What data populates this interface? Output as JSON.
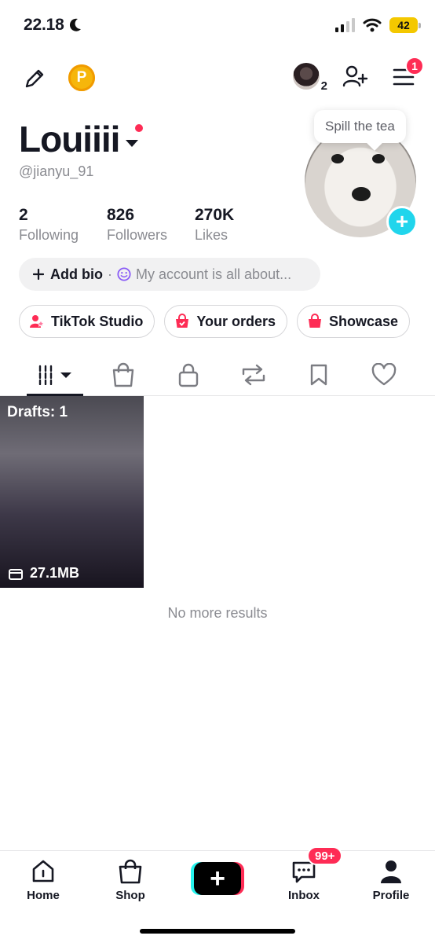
{
  "status_bar": {
    "time": "22.18",
    "battery": "42"
  },
  "profile": {
    "display_name": "Louiiii",
    "username": "@jianyu_91",
    "stats": [
      {
        "value": "2",
        "label": "Following"
      },
      {
        "value": "826",
        "label": "Followers"
      },
      {
        "value": "270K",
        "label": "Likes"
      }
    ],
    "bio": {
      "add_label": "Add bio",
      "separator": "·",
      "placeholder": "My account is all about..."
    },
    "avatar_tooltip": "Spill the tea"
  },
  "top_bar": {
    "friends_count": "2",
    "menu_badge": "1"
  },
  "quick_buttons": [
    {
      "label": "TikTok Studio",
      "icon": "studio-icon"
    },
    {
      "label": "Your orders",
      "icon": "orders-icon"
    },
    {
      "label": "Showcase",
      "icon": "showcase-icon"
    }
  ],
  "tabs": [
    {
      "name": "videos",
      "icon": "grid-icon",
      "active": true
    },
    {
      "name": "shop",
      "icon": "shopping-bag-icon"
    },
    {
      "name": "private",
      "icon": "lock-icon"
    },
    {
      "name": "reposts",
      "icon": "repost-icon"
    },
    {
      "name": "favorites",
      "icon": "bookmark-icon"
    },
    {
      "name": "liked",
      "icon": "heart-icon"
    }
  ],
  "drafts": {
    "label": "Drafts: 1",
    "size": "27.1MB"
  },
  "empty_message": "No more results",
  "bottom_nav": {
    "home": "Home",
    "shop": "Shop",
    "inbox": "Inbox",
    "inbox_badge": "99+",
    "profile": "Profile"
  },
  "colors": {
    "accent_red": "#fe2c55",
    "accent_cyan": "#20d5ec",
    "coin": "#f6b60b"
  }
}
